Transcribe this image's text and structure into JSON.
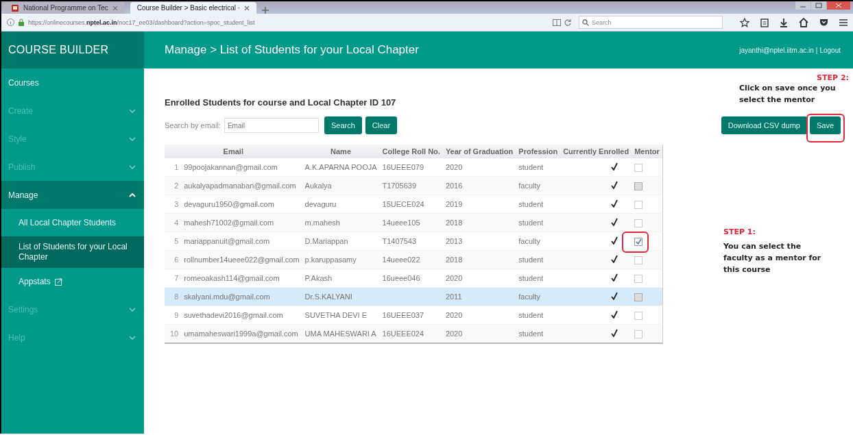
{
  "browser": {
    "tabs": [
      {
        "label": "National Programme on Tec",
        "selected": false
      },
      {
        "label": "Course Builder > Basic electrical ·",
        "selected": true
      }
    ],
    "url": "https://onlinecourses.**nptel.ac.in**/noc17_ee03/dashboard?action=spoc_student_list",
    "search_placeholder": "Search"
  },
  "sidebar": {
    "title": "COURSE BUILDER",
    "items": [
      {
        "label": "Courses",
        "kind": "link",
        "disabled": false
      },
      {
        "label": "Create",
        "kind": "section",
        "disabled": true,
        "expanded": false
      },
      {
        "label": "Style",
        "kind": "section",
        "disabled": true,
        "expanded": false
      },
      {
        "label": "Publish",
        "kind": "section",
        "disabled": true,
        "expanded": false
      },
      {
        "label": "Manage",
        "kind": "section",
        "disabled": false,
        "expanded": true,
        "children": [
          {
            "label": "All Local Chapter Students",
            "kind": "link",
            "selected": false
          },
          {
            "label": "List of Students for your Local Chapter",
            "kind": "link",
            "selected": true
          },
          {
            "label": "Appstats",
            "kind": "external",
            "selected": false
          }
        ]
      },
      {
        "label": "Settings",
        "kind": "section",
        "disabled": true,
        "expanded": false
      },
      {
        "label": "Help",
        "kind": "section",
        "disabled": true,
        "expanded": false
      }
    ]
  },
  "header": {
    "breadcrumb": "Manage > List of Students for your Local Chapter",
    "user": "jayanthi@nptel.iitm.ac.in",
    "separator": "|",
    "logout": "Logout"
  },
  "content": {
    "title": "Enrolled Students for course and Local Chapter ID 107",
    "search_label": "Search by email:",
    "search_placeholder": "Email",
    "buttons": [
      "Search",
      "Clear"
    ],
    "actions": [
      "Download CSV dump",
      "Save"
    ],
    "table": {
      "columns": [
        "Email",
        "Name",
        "College Roll No.",
        "Year of Graduation",
        "Profession",
        "Currently Enrolled",
        "Mentor"
      ],
      "rows": [
        {
          "number": "1",
          "email": "99poojakannan@gmail.com",
          "name": "A.K.APARNA POOJA",
          "roll": "16UEEE079",
          "year": "2020",
          "profession": "student",
          "enrolled": true,
          "mentor_checked": false,
          "mentor_disabled": false,
          "selected": false
        },
        {
          "number": "2",
          "email": "aukalyapadmanaban@gmail.com",
          "name": "Aukalya",
          "roll": "T1705639",
          "year": "2016",
          "profession": "faculty",
          "enrolled": true,
          "mentor_checked": false,
          "mentor_disabled": true,
          "selected": false
        },
        {
          "number": "3",
          "email": "devaguru1950@gmail.com",
          "name": "devaguru",
          "roll": "15UECE024",
          "year": "2019",
          "profession": "student",
          "enrolled": true,
          "mentor_checked": false,
          "mentor_disabled": false,
          "selected": false
        },
        {
          "number": "4",
          "email": "mahesh71002@gmail.com",
          "name": "m.mahesh",
          "roll": "14ueee105",
          "year": "2018",
          "profession": "student",
          "enrolled": true,
          "mentor_checked": false,
          "mentor_disabled": false,
          "selected": false
        },
        {
          "number": "5",
          "email": "mariappanuit@gmail.com",
          "name": "D.Mariappan",
          "roll": "T1407543",
          "year": "2013",
          "profession": "faculty",
          "enrolled": true,
          "mentor_checked": true,
          "mentor_disabled": false,
          "selected": false
        },
        {
          "number": "6",
          "email": "rollnumber14ueee022@gmail.com",
          "name": "p.karuppasamy",
          "roll": "14ueee022",
          "year": "2018",
          "profession": "student",
          "enrolled": true,
          "mentor_checked": false,
          "mentor_disabled": false,
          "selected": false
        },
        {
          "number": "7",
          "email": "romeoakash114@gmail.com",
          "name": "P.Akash",
          "roll": "16ueee046",
          "year": "2020",
          "profession": "student",
          "enrolled": true,
          "mentor_checked": false,
          "mentor_disabled": false,
          "selected": false
        },
        {
          "number": "8",
          "email": "skalyani.mdu@gmail.com",
          "name": "Dr.S.KALYANI",
          "year": "2011",
          "profession": "faculty",
          "enrolled": true,
          "mentor_checked": false,
          "mentor_disabled": true,
          "selected": true
        },
        {
          "number": "9",
          "email": "suvethadevi2016@gmail.com",
          "name": "SUVETHA DEVI E",
          "roll": "16UEEE037",
          "year": "2020",
          "profession": "student",
          "enrolled": true,
          "mentor_checked": false,
          "mentor_disabled": false,
          "selected": false
        },
        {
          "number": "10",
          "email": "umamaheswari1999a@gmail.com",
          "name": "UMA MAHESWARI A",
          "roll": "16UEEE024",
          "year": "2020",
          "profession": "student",
          "enrolled": true,
          "mentor_checked": false,
          "mentor_disabled": false,
          "selected": false
        }
      ]
    }
  },
  "annotations": [
    {
      "step": "STEP 2:",
      "text": "Click on save once you select the mentor"
    },
    {
      "step": "STEP 1:",
      "text": "You can select the faculty as a mentor for this course"
    }
  ]
}
